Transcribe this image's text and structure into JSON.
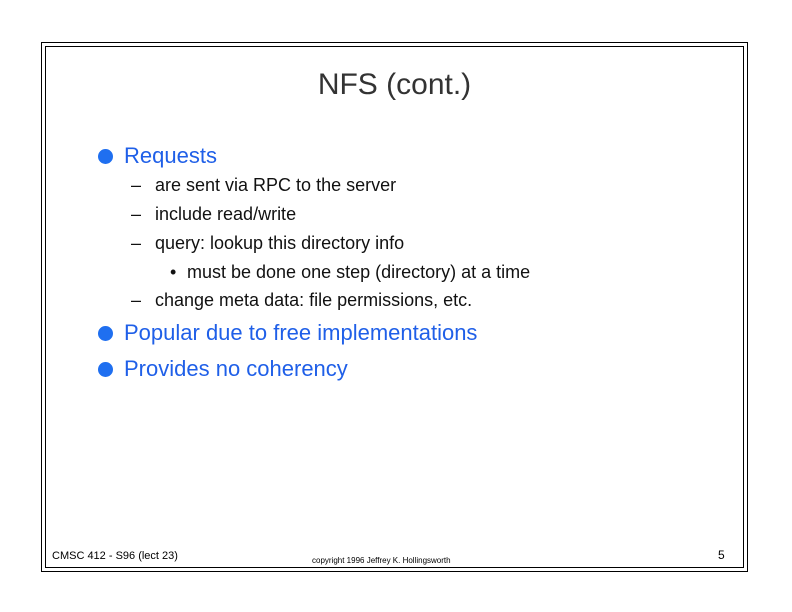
{
  "slide": {
    "title": "NFS (cont.)",
    "bullets": [
      {
        "text": "Requests"
      },
      {
        "text": "Popular due to free implementations"
      },
      {
        "text": "Provides no coherency"
      }
    ],
    "sub_items": [
      {
        "marker": "–",
        "text": "are sent via RPC to the server"
      },
      {
        "marker": "–",
        "text": "include read/write"
      },
      {
        "marker": "–",
        "text": "query: lookup this directory info"
      },
      {
        "marker": "–",
        "text": "change meta data: file permissions, etc."
      }
    ],
    "subsub_items": [
      {
        "marker": "•",
        "text": "must be done one step (directory) at a time"
      }
    ]
  },
  "footer": {
    "course": "CMSC 412 - S96  (lect 23)",
    "copyright": "copyright 1996  Jeffrey K. Hollingsworth",
    "page_number": "5"
  },
  "colors": {
    "bullet": "#1f6ff0",
    "bullet_text": "#1f5fe8",
    "title": "#333333"
  }
}
